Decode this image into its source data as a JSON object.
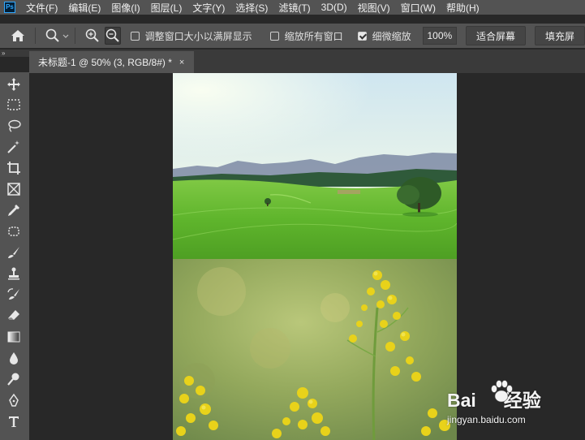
{
  "app": {
    "logo_text": "Ps"
  },
  "menu": {
    "items": [
      "文件(F)",
      "编辑(E)",
      "图像(I)",
      "图层(L)",
      "文字(Y)",
      "选择(S)",
      "滤镜(T)",
      "3D(D)",
      "视图(V)",
      "窗口(W)",
      "帮助(H)"
    ]
  },
  "options": {
    "resize_windows_label": "调整窗口大小以满屏显示",
    "resize_windows_checked": false,
    "zoom_all_label": "缩放所有窗口",
    "zoom_all_checked": false,
    "scrubby_zoom_label": "细微缩放",
    "scrubby_zoom_checked": true,
    "zoom_value": "100%",
    "fit_screen_label": "适合屏幕",
    "fill_screen_label": "填充屏"
  },
  "panel": {
    "collapse_label": "»"
  },
  "document": {
    "tab_title": "未标题-1 @ 50% (3, RGB/8#) *",
    "close_glyph": "×"
  },
  "tools": [
    "move-tool",
    "marquee-tool",
    "lasso-tool",
    "magic-wand-tool",
    "crop-tool",
    "frame-tool",
    "eyedropper-tool",
    "healing-brush-tool",
    "brush-tool",
    "clone-stamp-tool",
    "history-brush-tool",
    "eraser-tool",
    "gradient-tool",
    "blur-tool",
    "dodge-tool",
    "pen-tool",
    "type-tool"
  ],
  "watermark": {
    "brand_left": "Bai",
    "brand_right": "经验",
    "url": "jingyan.baidu.com"
  },
  "colors": {
    "menubar_bg": "#535353",
    "workspace_bg": "#282828",
    "accent": "#31a8ff"
  }
}
